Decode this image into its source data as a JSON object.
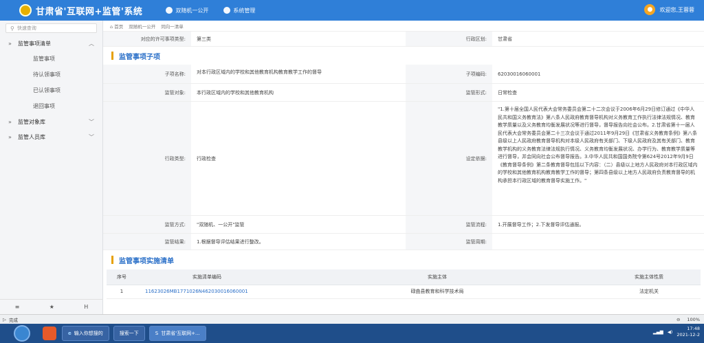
{
  "header": {
    "title": "甘肃省'互联网+监管'系统",
    "nav": [
      "双随机一公开",
      "系统管理"
    ],
    "user": "欢迎您,王蓉蓉"
  },
  "sidebar": {
    "search_placeholder": "快速查询",
    "groups": [
      {
        "label": "监管事项清单",
        "items": [
          "监管事项",
          "待认领事项",
          "已认领事项",
          "退回事项"
        ]
      },
      {
        "label": "监管对象库",
        "items": []
      },
      {
        "label": "监管人员库",
        "items": []
      }
    ],
    "bottom_icons": [
      "≡",
      "★",
      "H"
    ]
  },
  "breadcrumb": [
    "⌂ 首页",
    "双随机一公开",
    "同向一清单"
  ],
  "top_row": {
    "label1": "对应的许可事项类型:",
    "value1": "第三类",
    "label2": "行政区划:",
    "value2": "甘肃省"
  },
  "section1": {
    "title": "监管事项子项"
  },
  "subitem": {
    "name_label": "子项名称:",
    "name_value": "对本行政区域内的学校和其他教育机构教育教学工作的督导",
    "code_label": "子项编码:",
    "code_value": "62030016060001",
    "object_label": "监管对象:",
    "object_value": "本行政区域内的学校和其他教育机构",
    "form_label": "监管形式:",
    "form_value": "日常检查",
    "type_label": "行政类型:",
    "type_value": "行政检查",
    "basis_label": "设定依据:",
    "basis_value": "\"1.第十届全国人民代表大会常务委员会第二十二次会议于2006年6月29日修订通过《中华人民共和国义务教育法》第八条人民政府教育督导机构对义务教育工作执行法律法规情况、教育教学质量以及义务教育均衡发展状况等进行督导，督导报告向社会公布。2.甘肃省第十一届人民代表大会常务委员会第二十三次会议于通过2011年9月29日《甘肃省义务教育条例》第八条县级以上人民政府教育督导机构对本级人民政府有关部门、下级人民政府及其有关部门、教育教学机构的义务教育法律法规执行情况、义务教育均衡发展状况、办学行为、教育教学质量等进行督导，并会同向社会公布督导报告。3.中华人民共和国国务院令第624号2012年9月9日《教育督导条例》第二条教育督导包括以下内容：（二）县级以上地方人民政府对本行政区域内的学校和其他教育机构教育教学工作的督导；第四条县级以上地方人民政府负责教育督导的机构承担本行政区域的教育督导实施工作。\"",
    "method_label": "监管方式:",
    "method_value": "\"双随机、一公开\"监管",
    "process_label": "监管流程:",
    "process_value": "1.开展督导工作；2.下发督导评估通报。",
    "result_label": "监管结果:",
    "result_value": "1.根据督导评估结果进行整改。",
    "period_label": "监管周期:",
    "period_value": ""
  },
  "section2": {
    "title": "监管事项实施清单"
  },
  "impl_table": {
    "headers": [
      "序号",
      "实施清单编码",
      "实施主体",
      "实施主体性质"
    ],
    "rows": [
      [
        "1",
        "11623026MB1771026N462030016060001",
        "碌曲县教育和科学技术局",
        "法定机关"
      ]
    ]
  },
  "statusbar": {
    "left": "完成",
    "zoom": "100%"
  },
  "taskbar": {
    "buttons": [
      "输入你想搜的",
      "搜索一下",
      "甘肃省'互联网+..."
    ],
    "time": "17:48",
    "date": "2021-12-2"
  }
}
